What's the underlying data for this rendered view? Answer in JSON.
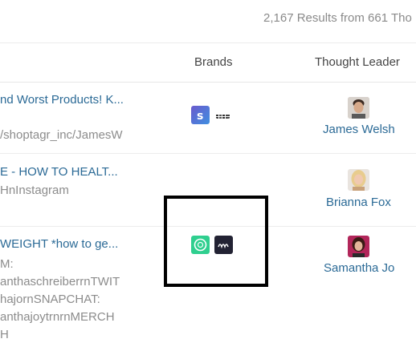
{
  "results": {
    "text": "2,167 Results from 661 Tho"
  },
  "columns": {
    "brands": "Brands",
    "thought_leader": "Thought Leader"
  },
  "rows": [
    {
      "title": "nd Worst Products! K...",
      "sub": "/shoptagr_inc/JamesW",
      "leader": "James Welsh",
      "brands": [
        "shoptagr-logo",
        "brand-text-logo"
      ]
    },
    {
      "title": "E - HOW TO HEALT...",
      "sub": "HnInstagram",
      "leader": "Brianna Fox",
      "brands": []
    },
    {
      "title": "WEIGHT *how to ge...",
      "desc": [
        "M:",
        "anthaschreiberrnTWIT",
        "hajornSNAPCHAT:",
        "anthajoytrnrnMERCH",
        "H"
      ],
      "leader": "Samantha Jo",
      "brands": [
        "green-circle-logo",
        "dark-script-logo"
      ]
    }
  ],
  "colors": {
    "link": "#2b6a96",
    "muted": "#8c8c8c",
    "highlight": "#000000"
  }
}
